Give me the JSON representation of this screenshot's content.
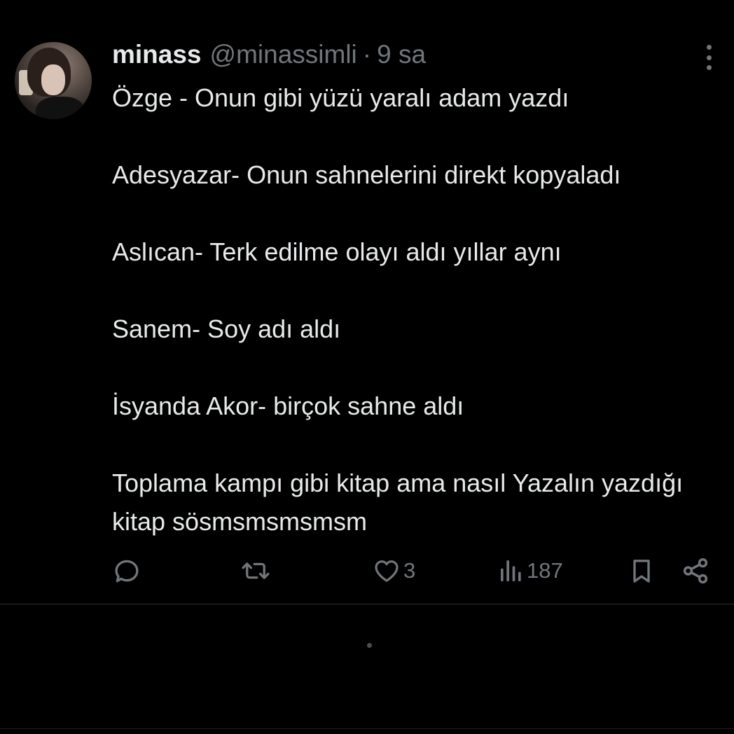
{
  "tweet": {
    "author_name": "minass",
    "author_handle": "@minassimli",
    "separator": "·",
    "time": "9 sa",
    "lines": [
      "Özge - Onun gibi yüzü yaralı adam yazdı",
      "Adesyazar- Onun sahnelerini direkt kopyaladı",
      "Aslıcan- Terk edilme olayı aldı yıllar aynı",
      "Sanem- Soy adı aldı",
      "İsyanda Akor- birçok sahne aldı",
      "Toplama kampı gibi kitap ama nasıl Yazalın yazdığı kitap sösmsmsmsmsm"
    ],
    "actions": {
      "likes": "3",
      "views": "187"
    }
  },
  "icons": {
    "more": "more-vertical-icon",
    "reply": "reply-icon",
    "retweet": "retweet-icon",
    "like": "heart-icon",
    "views": "views-icon",
    "bookmark": "bookmark-icon",
    "share": "share-icon"
  },
  "colors": {
    "background": "#000000",
    "text": "#e7e9ea",
    "secondary": "#71767b",
    "divider": "#2f3336"
  }
}
